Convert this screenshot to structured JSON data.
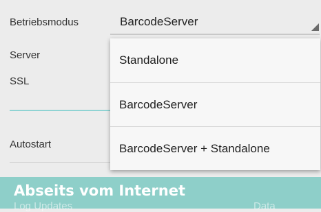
{
  "settings": {
    "mode_label": "Betriebsmodus",
    "mode_value": "BarcodeServer",
    "server_label": "Server",
    "ssl_label": "SSL",
    "autostart_label": "Autostart"
  },
  "dropdown": {
    "options": [
      "Standalone",
      "BarcodeServer",
      "BarcodeServer + Standalone"
    ],
    "selected": "BarcodeServer"
  },
  "banner": {
    "title": "Abseits vom Internet",
    "ghost_left": "Log Updates",
    "ghost_right": "Data"
  },
  "colors": {
    "accent_teal": "#8ecfc9",
    "background": "#ececec",
    "dropdown_bg": "#f7f7f7"
  }
}
